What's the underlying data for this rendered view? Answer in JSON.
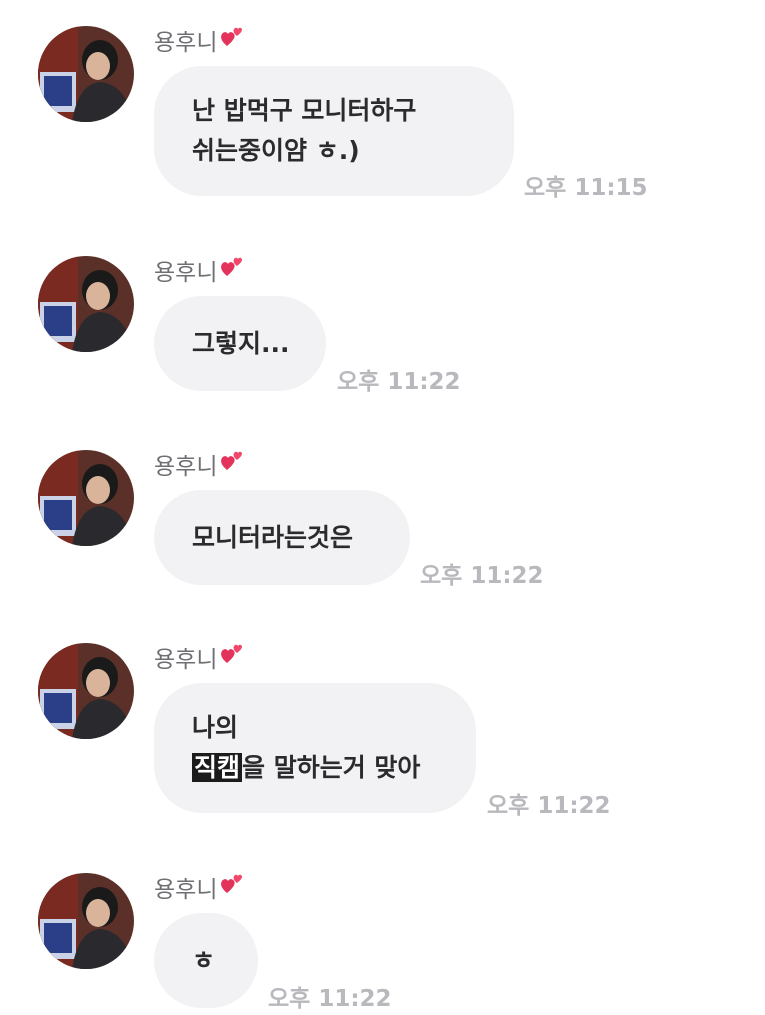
{
  "chat": {
    "messages": [
      {
        "sender": "용후니",
        "lines": [
          "난 밥먹구 모니터하구",
          "쉬는중이얌 ㅎ.)"
        ],
        "time": "오후 11:15"
      },
      {
        "sender": "용후니",
        "lines": [
          "그렇지..."
        ],
        "time": "오후 11:22"
      },
      {
        "sender": "용후니",
        "lines": [
          "모니터라는것은"
        ],
        "time": "오후 11:22"
      },
      {
        "sender": "용후니",
        "line1": "나의",
        "line2_highlight": "직캠",
        "line2_rest": "을 말하는거 맞아",
        "time": "오후 11:22"
      },
      {
        "sender": "용후니",
        "lines": [
          "ㅎ"
        ],
        "time": "오후 11:22"
      }
    ]
  },
  "icons": {
    "sender_emoji": "two-hearts-icon",
    "avatar": "avatar-photo"
  },
  "colors": {
    "bubble": "#f2f2f4",
    "text": "#2b2b2e",
    "sender": "#6f6f73",
    "time": "#b8b8bd",
    "highlight_bg": "#1c1c1c"
  }
}
